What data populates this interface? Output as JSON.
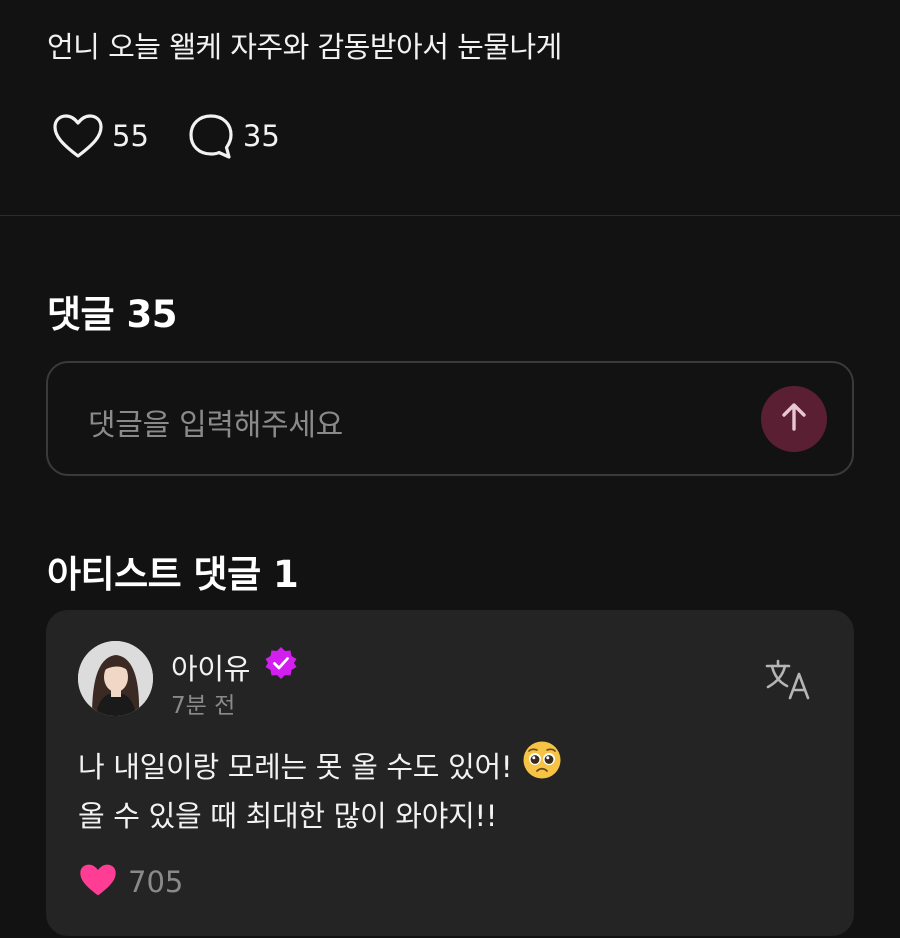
{
  "post": {
    "text": "언니 오늘 왤케 자주와 감동받아서 눈물나게",
    "like_count": "55",
    "comment_count": "35"
  },
  "comments_section": {
    "title": "댓글 35",
    "input": {
      "placeholder": "댓글을 입력해주세요"
    }
  },
  "artist_comments": {
    "title": "아티스트 댓글 1",
    "items": [
      {
        "author": "아이유",
        "time": "7분 전",
        "lines": [
          "나 내일이랑 모레는 못 올 수도 있어!",
          "올 수 있을 때 최대한 많이 와야지!!"
        ],
        "emoji": "pleading-face-icon",
        "likes": "705"
      }
    ]
  },
  "colors": {
    "background": "#121212",
    "card": "#242424",
    "send_button": "#5a1f33",
    "verified_badge": "#d21ff0",
    "like_heart": "#ff3d95"
  }
}
